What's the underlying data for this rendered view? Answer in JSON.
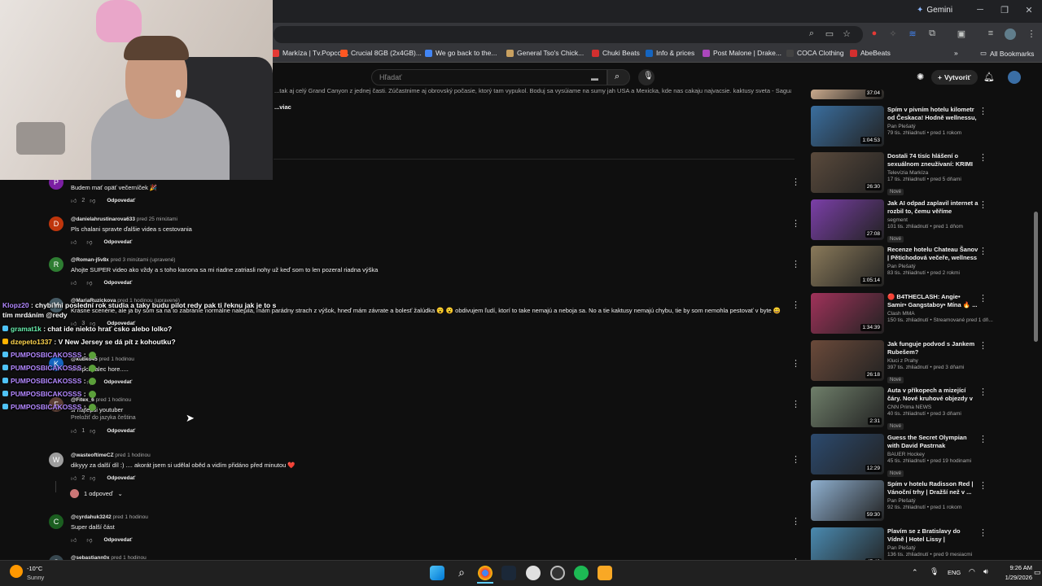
{
  "browser": {
    "gemini_label": "Gemini",
    "bookmarks": [
      {
        "label": "Markíza | Tv.Popcor...",
        "color": "#e53935"
      },
      {
        "label": "Crucial 8GB (2x4GB)...",
        "color": "#ff5722"
      },
      {
        "label": "We go back to the...",
        "color": "#4285f4"
      },
      {
        "label": "General Tso's Chick...",
        "color": "#c8a060"
      },
      {
        "label": "Chuki Beats",
        "color": "#d32f2f"
      },
      {
        "label": "Info & prices",
        "color": "#1565c0"
      },
      {
        "label": "Post Malone | Drake...",
        "color": "#ab47bc"
      },
      {
        "label": "COCA Clothing",
        "color": "#424242"
      },
      {
        "label": "AbeBeats",
        "color": "#d32f2f"
      }
    ],
    "all_bookmarks": "All Bookmarks"
  },
  "youtube": {
    "search_placeholder": "Hľadať",
    "create_label": "Vytvoriť",
    "description_text": "...tak aj celý Grand Canyon z jednej časti. Zúčastnime aj obrovský počasie, ktorý tam vypukol. Boduj sa vysúiame na sumy jah USA a Mexicka, kde nas cakaju najvacsie. kaktusy sveta - Saguaro. A",
    "description_more": "...viac",
    "reply_label": "Odpovedať"
  },
  "comments": [
    {
      "avatar_letter": "P",
      "avatar_color": "#7b1fa2",
      "author": "",
      "time": "",
      "text": "Budem mať opäť večerníček 🎉",
      "likes": "2"
    },
    {
      "avatar_letter": "D",
      "avatar_color": "#bf360c",
      "author": "@danielahrustinarova633",
      "time": "pred 25 minútami",
      "text": "Pls chalani spravte ďalšie videa  s cestovania",
      "likes": ""
    },
    {
      "avatar_letter": "R",
      "avatar_color": "#2e7d32",
      "author": "@Roman-j5v8x",
      "time": "pred 3 minútami (upravené)",
      "text": "Ahojte SUPER video ako vždy a s toho kanona sa mi riadne zatriasli nohy už keď som to len pozeral riadna výška",
      "likes": ""
    },
    {
      "avatar_letter": "M",
      "avatar_color": "#455a64",
      "author": "@MariaRuzickova",
      "time": "pred 1 hodinou (upravené)",
      "text": "Krásne scenérie, ale ja by som sa  na to zabráníe normálne nalepila, mám parádny strach z výšok, hneď mám závrate a bolesť žalúdka 😮 😮  obdivujem ľudí, ktorí to take nemajú a neboja sa. No a tie kaktusy nemajú chybu, tie by som nemohla pestovať v byte 😄",
      "likes": "3"
    },
    {
      "avatar_letter": "K",
      "avatar_color": "#1565c0",
      "author": "@kubko45",
      "time": "pred 1 hodinou",
      "text": "chlapci palec hore.....",
      "likes": ""
    },
    {
      "avatar_letter": "F",
      "avatar_color": "#5d4037",
      "author": "@Fitex_6",
      "time": "pred 1 hodinou",
      "text": "si najlepsi youtuber",
      "translate": "Preložiť do jazyka čeština",
      "likes": "1"
    },
    {
      "avatar_letter": "W",
      "avatar_color": "#9e9e9e",
      "author": "@wasteoftimeCZ",
      "time": "pred 1 hodinou",
      "text": "dikyyy za další díl :) .... akorát jsem si udělal oběd a vidím přidáno před minutou ❤️",
      "likes": "2",
      "replies": "1 odpoveď"
    },
    {
      "avatar_letter": "C",
      "avatar_color": "#1b5e20",
      "author": "@cyrdahuk3242",
      "time": "pred 1 hodinou",
      "text": "Super další část",
      "likes": ""
    },
    {
      "avatar_letter": "S",
      "avatar_color": "#37474f",
      "author": "@sebastiann0x",
      "time": "pred 1 hodinou",
      "text": "",
      "likes": ""
    }
  ],
  "chat": [
    {
      "user": "Klopz20",
      "color": "#b388ff",
      "text": ": chybí mi poslední rok studia a taky budu pilot redy pak ti řeknu jak je to s tím mrdáním @redy"
    },
    {
      "user": "gramat1k",
      "color": "#69f0ae",
      "text": ": chat ide niekto hrať csko alebo lolko?"
    },
    {
      "user": "dzepeto1337",
      "color": "#ffd54f",
      "text": ": V New Jersey se dá pít z kohoutku?"
    },
    {
      "user": "PUMPOSBICAKOSSS",
      "color": "#b388ff",
      "text": ":"
    },
    {
      "user": "PUMPOSBICAKOSSS",
      "color": "#b388ff",
      "text": ":"
    },
    {
      "user": "PUMPOSBICAKOSSS",
      "color": "#b388ff",
      "text": ":"
    },
    {
      "user": "PUMPOSBICAKOSSS",
      "color": "#b388ff",
      "text": ":"
    },
    {
      "user": "PUMPOSBICAKOSSS",
      "color": "#b388ff",
      "text": ":"
    }
  ],
  "sidebar": [
    {
      "title": "",
      "channel": "",
      "meta": "",
      "duration": "37:04",
      "thumb": "#c9a98c",
      "new": false
    },
    {
      "title": "Spím v pivním hotelu kilometr od Českaca! Hodně wellnessu, ...",
      "channel": "Pan Plešatý",
      "meta": "79 tis. zhliadnutí • pred 1 rokom",
      "duration": "1:04:53",
      "thumb": "#3a6e9e",
      "new": false
    },
    {
      "title": "Dostali 74 tisíc hlášení o sexuálnom zneužívaní: KRIMI ...",
      "channel": "Televízia Markíza",
      "meta": "17 tis. zhliadnutí • pred 5 dňami",
      "duration": "26:30",
      "thumb": "#5a4a3c",
      "new": true
    },
    {
      "title": "Jak AI odpad zaplavil internet a rozbil to, čemu věříme",
      "channel": "segment",
      "meta": "101 tis. zhliadnutí • pred 1 dňom",
      "duration": "27:08",
      "thumb": "#7b3fa8",
      "new": true
    },
    {
      "title": "Recenze hotelu Chateau Šanov | Pětichodová večeře, wellness ...",
      "channel": "Pan Plešatý",
      "meta": "83 tis. zhliadnutí • pred 2 rokmi",
      "duration": "1:05:14",
      "thumb": "#8a7a5a",
      "new": false
    },
    {
      "title": "🔴 B4THECLASH: Angie• Samir• Gangstaboy• Mína 🔥 ...",
      "channel": "Clash MMA",
      "meta": "150 tis. zhliadnutí • Streamované pred 1 dň...",
      "duration": "1:34:39",
      "thumb": "#a0325a",
      "new": false
    },
    {
      "title": "Jak funguje podvod s Jankem Rubešem?",
      "channel": "Kluci z Prahy",
      "meta": "397 tis. zhliadnutí • pred 3 dňami",
      "duration": "26:18",
      "thumb": "#6b4a3a",
      "new": true
    },
    {
      "title": "Auta v příkopech a mizející čáry. Nové kruhové objezdy v Česku...",
      "channel": "CNN Prima NEWS",
      "meta": "40 tis. zhliadnutí • pred 3 dňami",
      "duration": "2:31",
      "thumb": "#6f7f6a",
      "new": true
    },
    {
      "title": "Guess the Secret Olympian with David Pastrnak",
      "channel": "BAUER Hockey",
      "meta": "45 tis. zhliadnutí • pred 19 hodinami",
      "duration": "12:29",
      "thumb": "#2c4a6e",
      "new": true
    },
    {
      "title": "Spím v hotelu Radisson Red | Vánoční trhy | Dražší než v ...",
      "channel": "Pan Plešatý",
      "meta": "92 tis. zhliadnutí • pred 1 rokom",
      "duration": "59:30",
      "thumb": "#8fb0d0",
      "new": false
    },
    {
      "title": "Plavím se z Bratislavy do Vídně | Hotel Lissy | Rakouským vlake...",
      "channel": "Pan Plešatý",
      "meta": "136 tis. zhliadnutí • pred 9 mesiacmi",
      "duration": "47:48",
      "thumb": "#4a8ab0",
      "new": false
    }
  ],
  "taskbar": {
    "weather_temp": "-10°C",
    "weather_desc": "Sunny",
    "lang": "ENG",
    "time": "9:26 AM",
    "date": "1/29/2026"
  }
}
